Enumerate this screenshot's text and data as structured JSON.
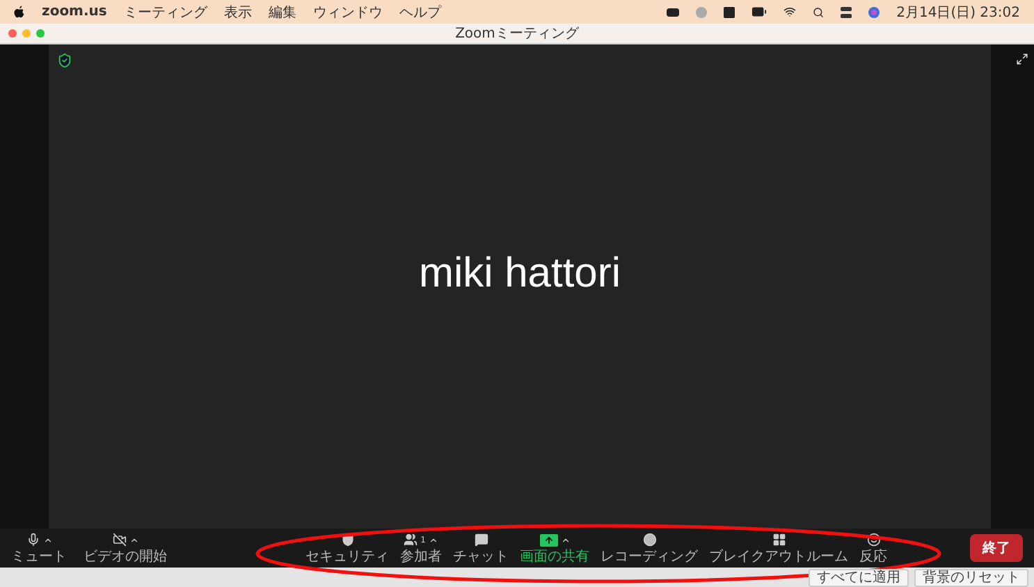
{
  "menu_bar": {
    "app": "zoom.us",
    "items": [
      "ミーティング",
      "表示",
      "編集",
      "ウィンドウ",
      "ヘルプ"
    ],
    "clock": "2月14日(日) 23:02"
  },
  "window": {
    "title": "Zoomミーティング"
  },
  "video": {
    "participant_name": "miki hattori"
  },
  "toolbar": {
    "left": [
      {
        "kind": "mic",
        "label": "ミュート",
        "caret": true,
        "active": false
      },
      {
        "kind": "video-off",
        "label": "ビデオの開始",
        "caret": true,
        "active": false
      }
    ],
    "center": [
      {
        "kind": "security",
        "label": "セキュリティ",
        "caret": false,
        "active": false
      },
      {
        "kind": "participants",
        "label": "参加者",
        "count": "1",
        "caret": true,
        "active": false
      },
      {
        "kind": "chat",
        "label": "チャット",
        "caret": false,
        "active": false
      },
      {
        "kind": "share",
        "label": "画面の共有",
        "caret": true,
        "active": true
      },
      {
        "kind": "record",
        "label": "レコーディング",
        "caret": false,
        "active": false
      },
      {
        "kind": "breakout",
        "label": "ブレイクアウトルーム",
        "caret": false,
        "active": false
      },
      {
        "kind": "reaction",
        "label": "反応",
        "caret": false,
        "active": false
      }
    ],
    "end_button": "終了"
  },
  "bottom_strip": {
    "buttons": [
      "すべてに適用",
      "背景のリセット"
    ]
  }
}
